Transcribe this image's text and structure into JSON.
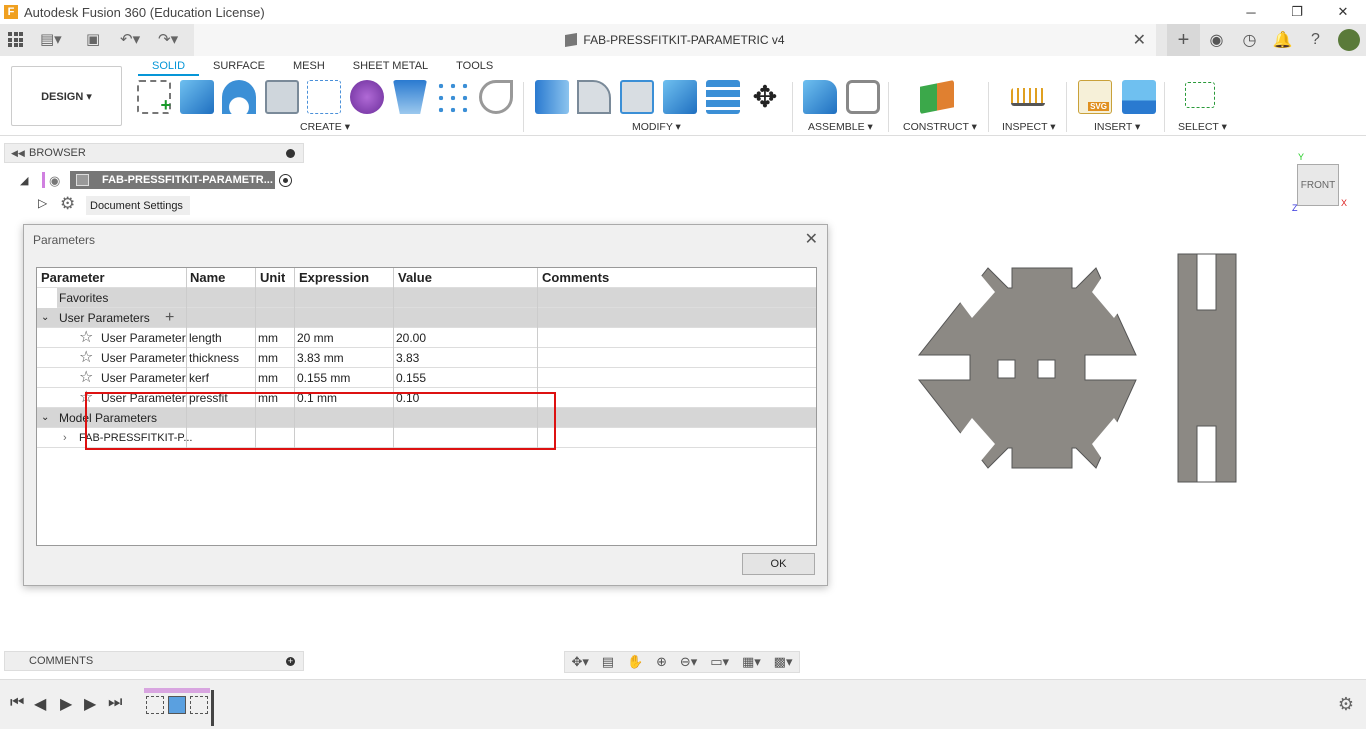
{
  "window": {
    "title": "Autodesk Fusion 360 (Education License)",
    "minimize": "─",
    "maximize": "❐",
    "close": "✕"
  },
  "document": {
    "title": "FAB-PRESSFITKIT-PARAMETRIC v4",
    "close": "✕"
  },
  "workspace": {
    "label": "DESIGN ▾"
  },
  "tabs": [
    "SOLID",
    "SURFACE",
    "MESH",
    "SHEET METAL",
    "TOOLS"
  ],
  "groups": {
    "create": "CREATE ▾",
    "modify": "MODIFY ▾",
    "assemble": "ASSEMBLE ▾",
    "construct": "CONSTRUCT ▾",
    "inspect": "INSPECT ▾",
    "insert": "INSERT ▾",
    "select": "SELECT ▾"
  },
  "browser": {
    "title": "BROWSER",
    "root": "FAB-PRESSFITKIT-PARAMETR...",
    "doc_settings": "Document Settings"
  },
  "dialog": {
    "title": "Parameters",
    "ok": "OK",
    "headers": [
      "Parameter",
      "Name",
      "Unit",
      "Expression",
      "Value",
      "Comments"
    ],
    "favorites": "Favorites",
    "user_group": "User Parameters",
    "model_group": "Model Parameters",
    "model_item": "FAB-PRESSFITKIT-P...",
    "rows": [
      {
        "type": "User Parameter",
        "name": "length",
        "unit": "mm",
        "expr": "20 mm",
        "value": "20.00"
      },
      {
        "type": "User Parameter",
        "name": "thickness",
        "unit": "mm",
        "expr": "3.83 mm",
        "value": "3.83"
      },
      {
        "type": "User Parameter",
        "name": "kerf",
        "unit": "mm",
        "expr": "0.155 mm",
        "value": "0.155"
      },
      {
        "type": "User Parameter",
        "name": "pressfit",
        "unit": "mm",
        "expr": "0.1 mm",
        "value": "0.10"
      }
    ]
  },
  "comments": {
    "title": "COMMENTS"
  },
  "viewcube": {
    "label": "FRONT",
    "x_axis": "X",
    "y_axis": "Y",
    "z_axis": "Z"
  },
  "colors": {
    "accent": "#0696d7",
    "highlight": "#dd1111",
    "part": "#8c8984"
  }
}
